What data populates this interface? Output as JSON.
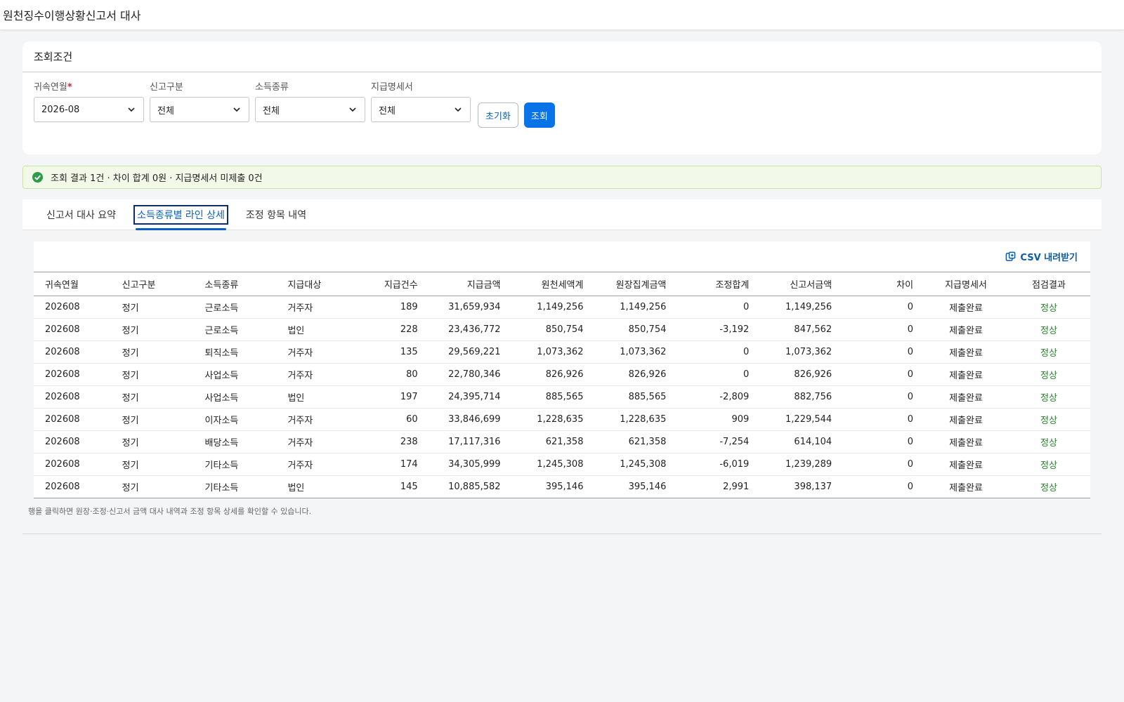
{
  "header": {
    "title": "원천징수이행상황신고서 대사"
  },
  "conditions": {
    "title": "조회조건",
    "fields": [
      {
        "label": "귀속연월",
        "required_mark": "*",
        "value": "2026-08"
      },
      {
        "label": "신고구분",
        "value": "전체"
      },
      {
        "label": "소득종류",
        "value": "전체"
      },
      {
        "label": "지급명세서",
        "value": "전체"
      }
    ],
    "reset_label": "초기화",
    "search_label": "조회"
  },
  "alert": {
    "text": "조회 결과 1건 · 차이 합계 0원 · 지급명세서 미제출 0건"
  },
  "tabs": [
    {
      "label": "신고서 대사 요약"
    },
    {
      "label": "소득종류별 라인 상세"
    },
    {
      "label": "조정 항목 내역"
    }
  ],
  "grid": {
    "csv_label": "CSV 내려받기",
    "columns": [
      "귀속연월",
      "신고구분",
      "소득종류",
      "지급대상",
      "지급건수",
      "지급금액",
      "원천세액계",
      "원장집계금액",
      "조정합계",
      "신고서금액",
      "차이",
      "지급명세서",
      "점검결과"
    ],
    "rows": [
      [
        "202608",
        "정기",
        "근로소득",
        "거주자",
        "189",
        "31,659,934",
        "1,149,256",
        "1,149,256",
        "0",
        "1,149,256",
        "0",
        "제출완료",
        "정상"
      ],
      [
        "202608",
        "정기",
        "근로소득",
        "법인",
        "228",
        "23,436,772",
        "850,754",
        "850,754",
        "-3,192",
        "847,562",
        "0",
        "제출완료",
        "정상"
      ],
      [
        "202608",
        "정기",
        "퇴직소득",
        "거주자",
        "135",
        "29,569,221",
        "1,073,362",
        "1,073,362",
        "0",
        "1,073,362",
        "0",
        "제출완료",
        "정상"
      ],
      [
        "202608",
        "정기",
        "사업소득",
        "거주자",
        "80",
        "22,780,346",
        "826,926",
        "826,926",
        "0",
        "826,926",
        "0",
        "제출완료",
        "정상"
      ],
      [
        "202608",
        "정기",
        "사업소득",
        "법인",
        "197",
        "24,395,714",
        "885,565",
        "885,565",
        "-2,809",
        "882,756",
        "0",
        "제출완료",
        "정상"
      ],
      [
        "202608",
        "정기",
        "이자소득",
        "거주자",
        "60",
        "33,846,699",
        "1,228,635",
        "1,228,635",
        "909",
        "1,229,544",
        "0",
        "제출완료",
        "정상"
      ],
      [
        "202608",
        "정기",
        "배당소득",
        "거주자",
        "238",
        "17,117,316",
        "621,358",
        "621,358",
        "-7,254",
        "614,104",
        "0",
        "제출완료",
        "정상"
      ],
      [
        "202608",
        "정기",
        "기타소득",
        "거주자",
        "174",
        "34,305,999",
        "1,245,308",
        "1,245,308",
        "-6,019",
        "1,239,289",
        "0",
        "제출완료",
        "정상"
      ],
      [
        "202608",
        "정기",
        "기타소득",
        "법인",
        "145",
        "10,885,582",
        "395,146",
        "395,146",
        "2,991",
        "398,137",
        "0",
        "제출완료",
        "정상"
      ]
    ],
    "hint": "행을 클릭하면 원장·조정·신고서 금액 대사 내역과 조정 항목 상세를 확인할 수 있습니다."
  }
}
